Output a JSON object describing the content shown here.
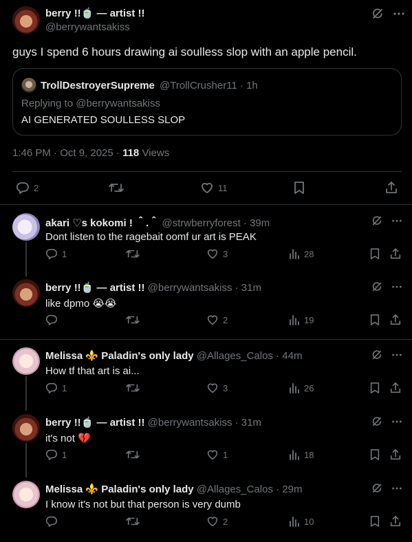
{
  "main_tweet": {
    "author_name": "berry !!🍵 — artist !!",
    "author_handle": "@berrywantsakiss",
    "text": "guys I spend 6 hours drawing ai soulless slop with an apple pencil.",
    "quote": {
      "author_name": "TrollDestroyerSupreme",
      "author_handle": "@TrollCrusher11 · 1h",
      "replying_to": "Replying to @berrywantsakiss",
      "text": "AI GENERATED SOULLESS SLOP"
    },
    "timestamp": "1:46 PM · Oct 9, 2025 · ",
    "views_count": "118",
    "views_label": " Views",
    "reply_count": "2",
    "like_count": "11"
  },
  "replies": [
    {
      "author_name": "akari ♡s kokomi ! ＾.＾",
      "author_handle": "@strwberryforest · 39m",
      "text": "Dont listen to the ragebait oomf ur art is PEAK",
      "reply_count": "1",
      "retweet_count": "",
      "like_count": "3",
      "view_count": "28"
    },
    {
      "author_name": "berry !!🍵 — artist !!",
      "author_handle": "@berrywantsakiss · 31m",
      "text": "like dpmo 😭😭",
      "reply_count": "",
      "retweet_count": "",
      "like_count": "2",
      "view_count": "19"
    },
    {
      "author_name": "Melissa ⚜️ Paladin's only lady",
      "author_handle": "@Allages_Calos · 44m",
      "text": "How tf that art is ai...",
      "reply_count": "1",
      "retweet_count": "",
      "like_count": "3",
      "view_count": "26"
    },
    {
      "author_name": "berry !!🍵 — artist !!",
      "author_handle": "@berrywantsakiss · 31m",
      "text": "it's not 💔",
      "reply_count": "1",
      "retweet_count": "",
      "like_count": "1",
      "view_count": "18"
    },
    {
      "author_name": "Melissa ⚜️ Paladin's only lady",
      "author_handle": "@Allages_Calos · 29m",
      "text": "I know it's not but that person is very dumb",
      "reply_count": "",
      "retweet_count": "",
      "like_count": "2",
      "view_count": "10"
    }
  ],
  "icons": {
    "grok": "grok-icon",
    "more": "more-icon",
    "reply": "reply-icon",
    "retweet": "retweet-icon",
    "like": "heart-icon",
    "views": "views-icon",
    "bookmark": "bookmark-icon",
    "share": "share-icon"
  },
  "colors": {
    "background": "#000000",
    "text": "#e7e9ea",
    "muted": "#71767b",
    "border": "#2f3336"
  }
}
